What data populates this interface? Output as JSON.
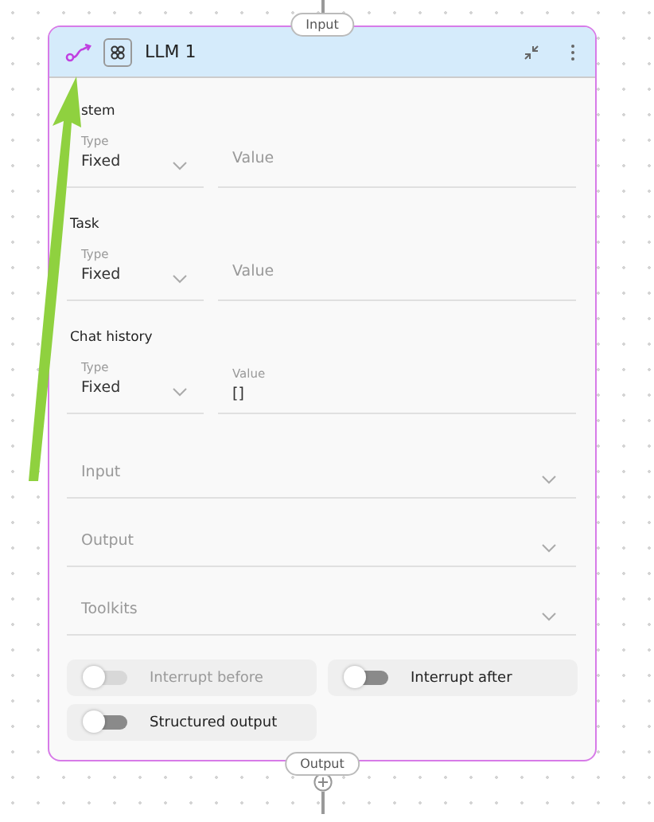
{
  "input_handle": "Input",
  "output_handle": "Output",
  "header": {
    "title": "LLM 1"
  },
  "sections": [
    {
      "label": "stem",
      "type": {
        "label": "Type",
        "value": "Fixed"
      },
      "value": {
        "placeholder": "Value"
      }
    },
    {
      "label": "Task",
      "type": {
        "label": "Type",
        "value": "Fixed"
      },
      "value": {
        "placeholder": "Value"
      }
    },
    {
      "label": "Chat history",
      "type": {
        "label": "Type",
        "value": "Fixed"
      },
      "value": {
        "label": "Value",
        "text": "[]"
      }
    }
  ],
  "dropdowns": [
    {
      "placeholder": "Input"
    },
    {
      "placeholder": "Output"
    },
    {
      "placeholder": "Toolkits"
    }
  ],
  "toggles": [
    {
      "label": "Interrupt before",
      "on": false,
      "disabled": true
    },
    {
      "label": "Interrupt after",
      "on": false,
      "disabled": false
    },
    {
      "label": "Structured output",
      "on": false,
      "disabled": false
    }
  ]
}
